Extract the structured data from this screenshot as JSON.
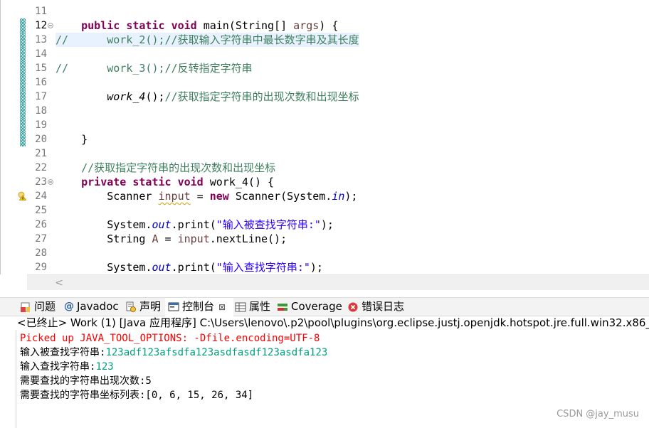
{
  "editor": {
    "lines": [
      {
        "n": "11",
        "code": ""
      },
      {
        "n": "12",
        "code": "    public static void main(String[] args) {",
        "fold": true
      },
      {
        "n": "13",
        "code": "//      work_2();//获取输入字符串中最长数字串及其长度",
        "highlight": true
      },
      {
        "n": "14",
        "code": ""
      },
      {
        "n": "15",
        "code": "//      work_3();//反转指定字符串"
      },
      {
        "n": "16",
        "code": ""
      },
      {
        "n": "17",
        "code": "        work_4();//获取指定字符串的出现次数和出现坐标"
      },
      {
        "n": "18",
        "code": ""
      },
      {
        "n": "19",
        "code": ""
      },
      {
        "n": "20",
        "code": "    }"
      },
      {
        "n": "21",
        "code": ""
      },
      {
        "n": "22",
        "code": "    //获取指定字符串的出现次数和出现坐标"
      },
      {
        "n": "23",
        "code": "    private static void work_4() {",
        "fold": true
      },
      {
        "n": "24",
        "code": "        Scanner input = new Scanner(System.in);",
        "warning": true
      },
      {
        "n": "25",
        "code": ""
      },
      {
        "n": "26",
        "code": "        System.out.print(\"输入被查找字符串:\");"
      },
      {
        "n": "27",
        "code": "        String A = input.nextLine();"
      },
      {
        "n": "28",
        "code": ""
      },
      {
        "n": "29",
        "code": "        System.out.print(\"输入查找字符串:\");"
      }
    ],
    "scroll_left_arrow": "<"
  },
  "tabs": [
    {
      "label": "问题",
      "icon": "problems-icon"
    },
    {
      "label": "Javadoc",
      "icon": "javadoc-icon"
    },
    {
      "label": "声明",
      "icon": "declaration-icon"
    },
    {
      "label": "控制台",
      "icon": "console-icon",
      "active": true,
      "close": "⊠"
    },
    {
      "label": "属性",
      "icon": "properties-icon"
    },
    {
      "label": "Coverage",
      "icon": "coverage-icon"
    },
    {
      "label": "错误日志",
      "icon": "error-log-icon"
    }
  ],
  "console": {
    "header": "<已终止> Work (1)  [Java 应用程序] C:\\Users\\lenovo\\.p2\\pool\\plugins\\org.eclipse.justj.openjdk.hotspot.jre.full.win32.x86_",
    "lines": [
      {
        "text": "Picked up JAVA_TOOL_OPTIONS: -Dfile.encoding=UTF-8",
        "style": "err"
      },
      {
        "prompt": "输入被查找字符串:",
        "input": "123adf123afsdfa123asdfasdf123asdfa123"
      },
      {
        "prompt": "输入查找字符串:",
        "input": "123"
      },
      {
        "text": "需要查找的字符串出现次数:5"
      },
      {
        "text": "需要查找的字符串坐标列表:[0, 6, 15, 26, 34]"
      }
    ]
  },
  "watermark": "CSDN @jay_musu"
}
